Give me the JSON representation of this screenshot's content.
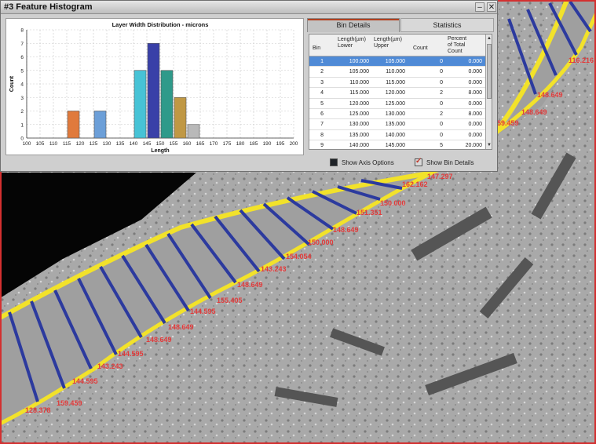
{
  "window": {
    "title": "#3 Feature Histogram",
    "minimize_glyph": "–",
    "close_glyph": "✕"
  },
  "chart_data": {
    "type": "bar",
    "title": "Layer Width Distribution - microns",
    "xlabel": "Length",
    "ylabel": "Count",
    "x_ticks": [
      "100",
      "105",
      "110",
      "115",
      "120",
      "125",
      "130",
      "135",
      "140",
      "145",
      "150",
      "155",
      "160",
      "165",
      "170",
      "175",
      "180",
      "185",
      "190",
      "195",
      "200"
    ],
    "y_ticks": [
      "0",
      "1",
      "2",
      "3",
      "4",
      "5",
      "6",
      "7",
      "8"
    ],
    "xlim": [
      100,
      200
    ],
    "ylim": [
      0,
      8
    ],
    "grid": true,
    "bins": [
      {
        "lower": 115,
        "upper": 120,
        "count": 2,
        "color": "#e07a3c"
      },
      {
        "lower": 125,
        "upper": 130,
        "count": 2,
        "color": "#6c9fd8"
      },
      {
        "lower": 140,
        "upper": 145,
        "count": 5,
        "color": "#47c3d6"
      },
      {
        "lower": 145,
        "upper": 150,
        "count": 7,
        "color": "#3940a8"
      },
      {
        "lower": 150,
        "upper": 155,
        "count": 5,
        "color": "#2f9a8a"
      },
      {
        "lower": 155,
        "upper": 160,
        "count": 3,
        "color": "#c09844"
      },
      {
        "lower": 160,
        "upper": 165,
        "count": 1,
        "color": "#b9b9b9"
      }
    ]
  },
  "tabs": {
    "bin_details": "Bin Details",
    "statistics": "Statistics"
  },
  "table": {
    "headers": {
      "bin": "Bin",
      "lower": "Length(µm)\nLower",
      "upper": "Length(µm)\nUpper",
      "count": "Count",
      "percent": "Percent\nof Total\nCount"
    },
    "rows": [
      {
        "bin": "1",
        "lower": "100.000",
        "upper": "105.000",
        "count": "0",
        "percent": "0.000"
      },
      {
        "bin": "2",
        "lower": "105.000",
        "upper": "110.000",
        "count": "0",
        "percent": "0.000"
      },
      {
        "bin": "3",
        "lower": "110.000",
        "upper": "115.000",
        "count": "0",
        "percent": "0.000"
      },
      {
        "bin": "4",
        "lower": "115.000",
        "upper": "120.000",
        "count": "2",
        "percent": "8.000"
      },
      {
        "bin": "5",
        "lower": "120.000",
        "upper": "125.000",
        "count": "0",
        "percent": "0.000"
      },
      {
        "bin": "6",
        "lower": "125.000",
        "upper": "130.000",
        "count": "2",
        "percent": "8.000"
      },
      {
        "bin": "7",
        "lower": "130.000",
        "upper": "135.000",
        "count": "0",
        "percent": "0.000"
      },
      {
        "bin": "8",
        "lower": "135.000",
        "upper": "140.000",
        "count": "0",
        "percent": "0.000"
      },
      {
        "bin": "9",
        "lower": "140.000",
        "upper": "145.000",
        "count": "5",
        "percent": "20.000"
      }
    ],
    "scroll_up": "▲",
    "scroll_down": "▼"
  },
  "options": {
    "show_axis_options": "Show Axis Options",
    "show_bin_details": "Show Bin Details"
  },
  "measurements": [
    "128.378",
    "159.459",
    "144.595",
    "143.243",
    "144.595",
    "148.649",
    "148.649",
    "144.595",
    "155.405",
    "148.649",
    "143.243",
    "154.054",
    "150.000",
    "148.649",
    "151.351",
    "150.000",
    "162.162",
    "147.297",
    "159.459",
    "148.649",
    "148.649",
    "116.216"
  ],
  "colors": {
    "measure_line": "#2c3a9e",
    "boundary": "#f2e22a",
    "label_text": "#e23a3a",
    "frame": "#d43030"
  }
}
